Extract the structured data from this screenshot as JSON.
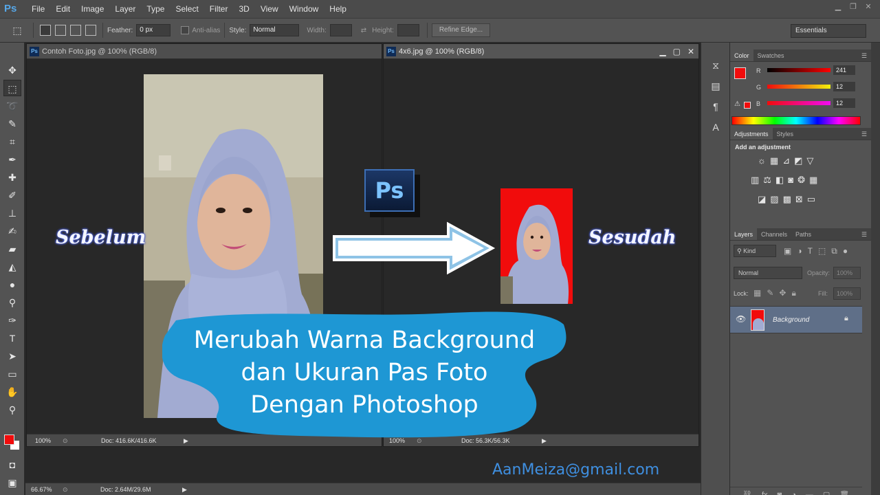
{
  "app": {
    "logo": "Ps",
    "menu": [
      "File",
      "Edit",
      "Image",
      "Layer",
      "Type",
      "Select",
      "Filter",
      "3D",
      "View",
      "Window",
      "Help"
    ]
  },
  "options": {
    "feather_label": "Feather:",
    "feather_value": "0 px",
    "antialias_label": "Anti-alias",
    "style_label": "Style:",
    "style_value": "Normal",
    "width_label": "Width:",
    "height_label": "Height:",
    "refine_edge": "Refine Edge...",
    "workspace": "Essentials"
  },
  "documents": [
    {
      "title": "Contoh Foto.jpg @ 100% (RGB/8)",
      "zoom": "100%",
      "doc": "Doc: 416.6K/416.6K"
    },
    {
      "title": "4x6.jpg @ 100% (RGB/8)",
      "zoom": "100%",
      "doc": "Doc: 56.3K/56.3K"
    }
  ],
  "bottom_status": {
    "zoom": "66.67%",
    "doc": "Doc: 2.64M/29.6M"
  },
  "color_panel": {
    "tabs": [
      "Color",
      "Swatches"
    ],
    "r_label": "R",
    "r_value": "241",
    "g_label": "G",
    "g_value": "12",
    "b_label": "B",
    "b_value": "12",
    "foreground_color": "#f10c0c"
  },
  "adjustments_panel": {
    "tabs": [
      "Adjustments",
      "Styles"
    ],
    "heading": "Add an adjustment"
  },
  "layers_panel": {
    "tabs": [
      "Layers",
      "Channels",
      "Paths"
    ],
    "filter": "Kind",
    "blend_mode": "Normal",
    "opacity_label": "Opacity:",
    "opacity_value": "100%",
    "lock_label": "Lock:",
    "fill_label": "Fill:",
    "fill_value": "100%",
    "layer_name": "Background"
  },
  "overlay": {
    "before": "Sebelum",
    "after": "Sesudah",
    "title_line1": "Merubah Warna Background",
    "title_line2": "dan Ukuran Pas Foto",
    "title_line3": "Dengan Photoshop",
    "email": "AanMeiza@gmail.com",
    "ps_badge": "Ps"
  }
}
